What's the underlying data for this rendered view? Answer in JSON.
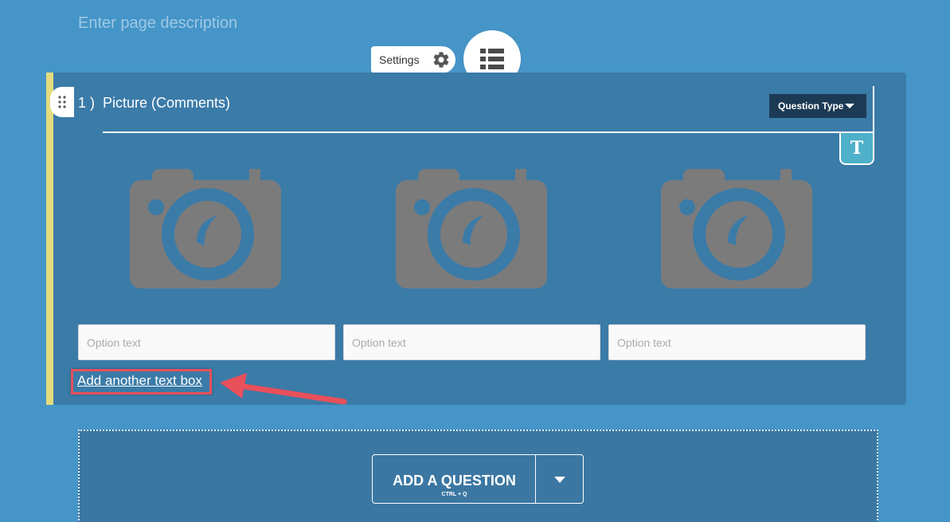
{
  "page": {
    "description_placeholder": "Enter page description"
  },
  "toolbar": {
    "settings_label": "Settings",
    "settings_icon": "gear-icon",
    "list_icon": "list-icon"
  },
  "question": {
    "number": "1 )",
    "title": "Picture (Comments)",
    "type_button_label": "Question Type",
    "text_badge": "T",
    "cameras": [
      "camera-icon",
      "camera-icon",
      "camera-icon"
    ],
    "options": [
      {
        "placeholder": "Option text",
        "value": ""
      },
      {
        "placeholder": "Option text",
        "value": ""
      },
      {
        "placeholder": "Option text",
        "value": ""
      }
    ],
    "add_text_box_label": "Add another text box"
  },
  "add_question": {
    "label": "ADD A QUESTION",
    "shortcut": "CTRL + Q"
  },
  "colors": {
    "background": "#4595c8",
    "card": "#3b7ba8",
    "card_accent": "#e4dc7e",
    "qtype_button": "#1d3a54",
    "t_badge": "#4eb0c9",
    "highlight": "#e8505b",
    "camera_gray": "#7b7b7b"
  }
}
